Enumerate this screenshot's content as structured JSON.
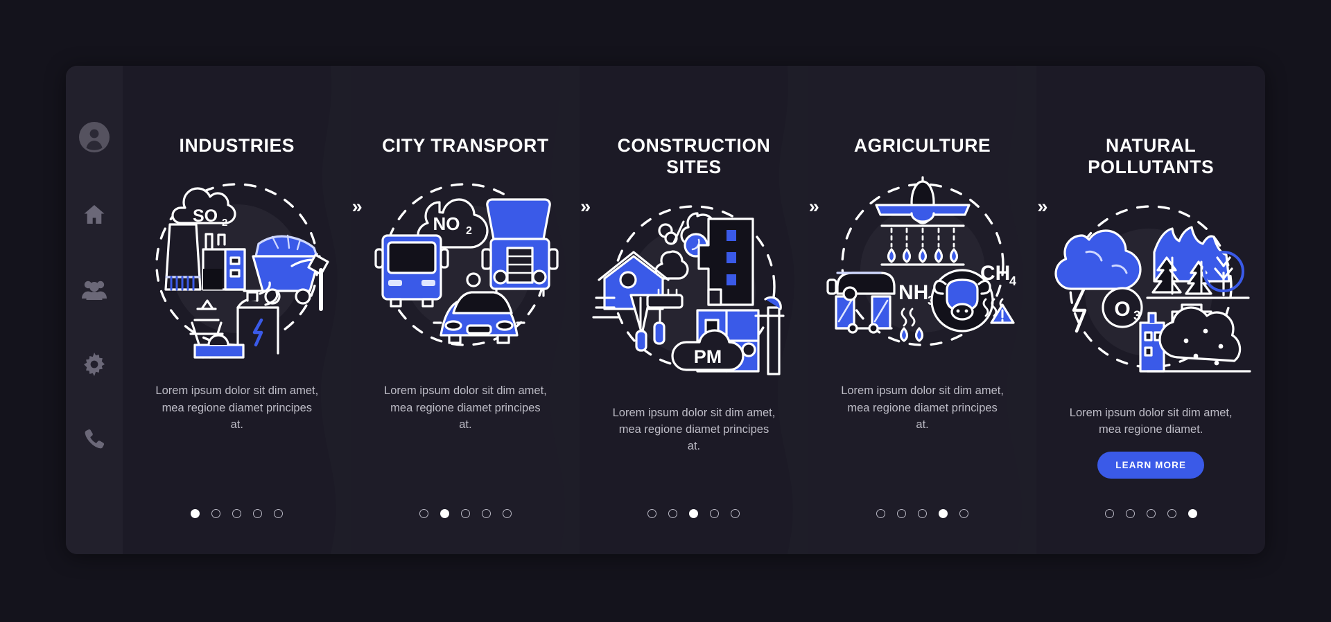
{
  "theme": {
    "page_background": "#14131c",
    "card_background": "#1e1d28",
    "sidebar_background": "#22202c",
    "accent_blue": "#3a5ae8",
    "illustration_blue": "#3a5ae8",
    "illustration_line": "#ffffff",
    "title_color": "#ffffff",
    "body_color": "#bdbcc6"
  },
  "sidebar": {
    "items": [
      {
        "icon": "avatar-icon",
        "name": "sidebar-item-account"
      },
      {
        "icon": "home-icon",
        "name": "sidebar-item-home"
      },
      {
        "icon": "people-icon",
        "name": "sidebar-item-people"
      },
      {
        "icon": "gear-icon",
        "name": "sidebar-item-settings"
      },
      {
        "icon": "phone-icon",
        "name": "sidebar-item-contact"
      }
    ]
  },
  "separator": {
    "glyph": "»",
    "name": "chevron-right-double-icon"
  },
  "pagination": {
    "total": 5
  },
  "panels": [
    {
      "title": "INDUSTRIES",
      "body": "Lorem ipsum dolor sit dim amet, mea regione diamet principes at.",
      "active_dot": 1,
      "illustration": "industries-illustration",
      "illustration_labels": [
        "SO₂"
      ],
      "has_cta": false,
      "cta_label": ""
    },
    {
      "title": "CITY TRANSPORT",
      "body": "Lorem ipsum dolor sit dim amet, mea regione diamet principes at.",
      "active_dot": 2,
      "illustration": "city-transport-illustration",
      "illustration_labels": [
        "NO₂"
      ],
      "has_cta": false,
      "cta_label": ""
    },
    {
      "title": "CONSTRUCTION SITES",
      "body": "Lorem ipsum dolor sit dim amet, mea regione diamet principes at.",
      "active_dot": 3,
      "illustration": "construction-sites-illustration",
      "illustration_labels": [
        "PM"
      ],
      "has_cta": false,
      "cta_label": ""
    },
    {
      "title": "AGRICULTURE",
      "body": "Lorem ipsum dolor sit dim amet, mea regione diamet principes at.",
      "active_dot": 4,
      "illustration": "agriculture-illustration",
      "illustration_labels": [
        "NH₃",
        "CH₄"
      ],
      "has_cta": false,
      "cta_label": ""
    },
    {
      "title": "NATURAL POLLUTANTS",
      "body": "Lorem ipsum dolor sit dim amet, mea regione diamet.",
      "active_dot": 5,
      "illustration": "natural-pollutants-illustration",
      "illustration_labels": [
        "O₃"
      ],
      "has_cta": true,
      "cta_label": "LEARN MORE"
    }
  ]
}
